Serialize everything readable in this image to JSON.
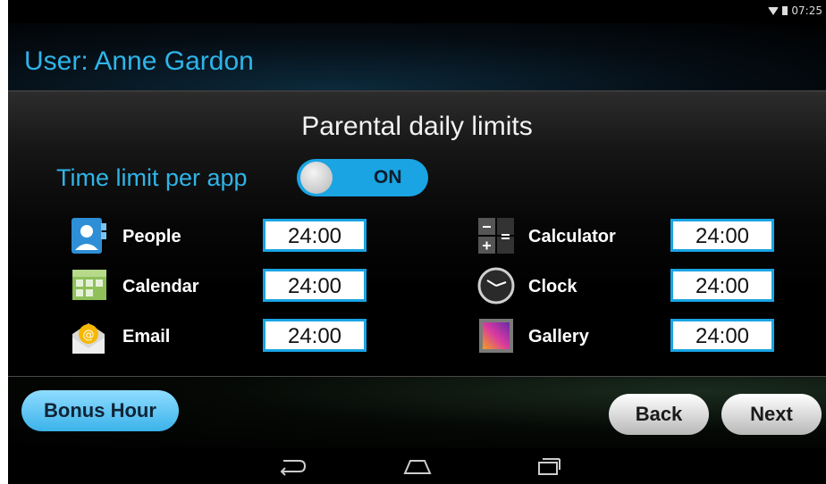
{
  "status_bar": {
    "time": "07:25",
    "icons": [
      "wifi-icon",
      "battery-icon"
    ]
  },
  "header": {
    "title": "User: Anne Gardon"
  },
  "panel": {
    "heading": "Parental daily limits",
    "time_limit": {
      "label": "Time limit per app",
      "state": "ON"
    },
    "apps_left": [
      {
        "name": "People",
        "icon": "people-icon",
        "limit": "24:00"
      },
      {
        "name": "Calendar",
        "icon": "calendar-icon",
        "limit": "24:00"
      },
      {
        "name": "Email",
        "icon": "email-icon",
        "limit": "24:00"
      }
    ],
    "apps_right": [
      {
        "name": "Calculator",
        "icon": "calculator-icon",
        "limit": "24:00"
      },
      {
        "name": "Clock",
        "icon": "clock-icon",
        "limit": "24:00"
      },
      {
        "name": "Gallery",
        "icon": "gallery-icon",
        "limit": "24:00"
      }
    ]
  },
  "footer": {
    "bonus_label": "Bonus Hour",
    "back_label": "Back",
    "next_label": "Next"
  },
  "navbar": {
    "icons": [
      "back-nav-icon",
      "home-nav-icon",
      "recents-nav-icon"
    ]
  },
  "colors": {
    "accent": "#2fb4e8",
    "toggle": "#1aa4e3",
    "background": "#000000"
  }
}
